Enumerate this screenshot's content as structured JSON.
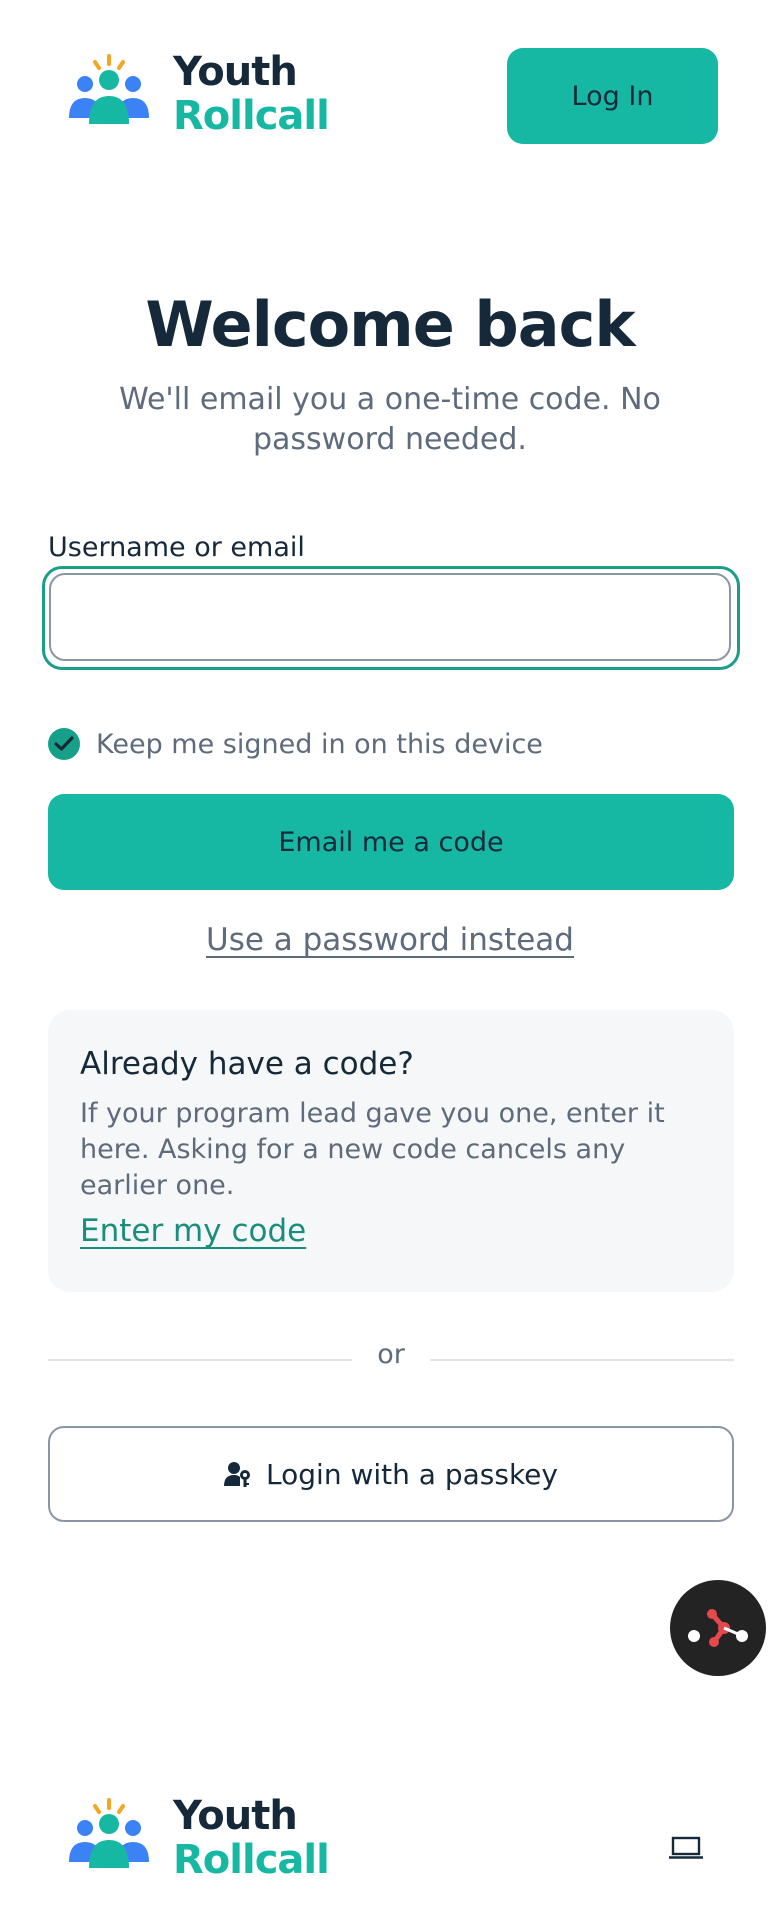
{
  "header": {
    "brand_line1": "Youth",
    "brand_line2": "Rollcall",
    "login_label": "Log In"
  },
  "main": {
    "title": "Welcome back",
    "subtitle": "We'll email you a one-time code. No password needed.",
    "field_label": "Username or email",
    "field_value": "",
    "remember_label": "Keep me signed in on this device",
    "remember_checked": true,
    "email_button": "Email me a code",
    "password_link": "Use a password instead"
  },
  "code_card": {
    "title": "Already have a code?",
    "body": "If your program lead gave you one, enter it here. Asking for a new code cancels any earlier one.",
    "link": "Enter my code"
  },
  "divider_label": "or",
  "passkey_button": "Login with a passkey",
  "footer": {
    "brand_line1": "Youth",
    "brand_line2": "Rollcall"
  },
  "colors": {
    "brand_teal": "#16b8a3",
    "brand_navy": "#15293a",
    "muted_text": "#5e6b7c",
    "logo_blue": "#3b82f6",
    "logo_orange": "#f5a623"
  }
}
